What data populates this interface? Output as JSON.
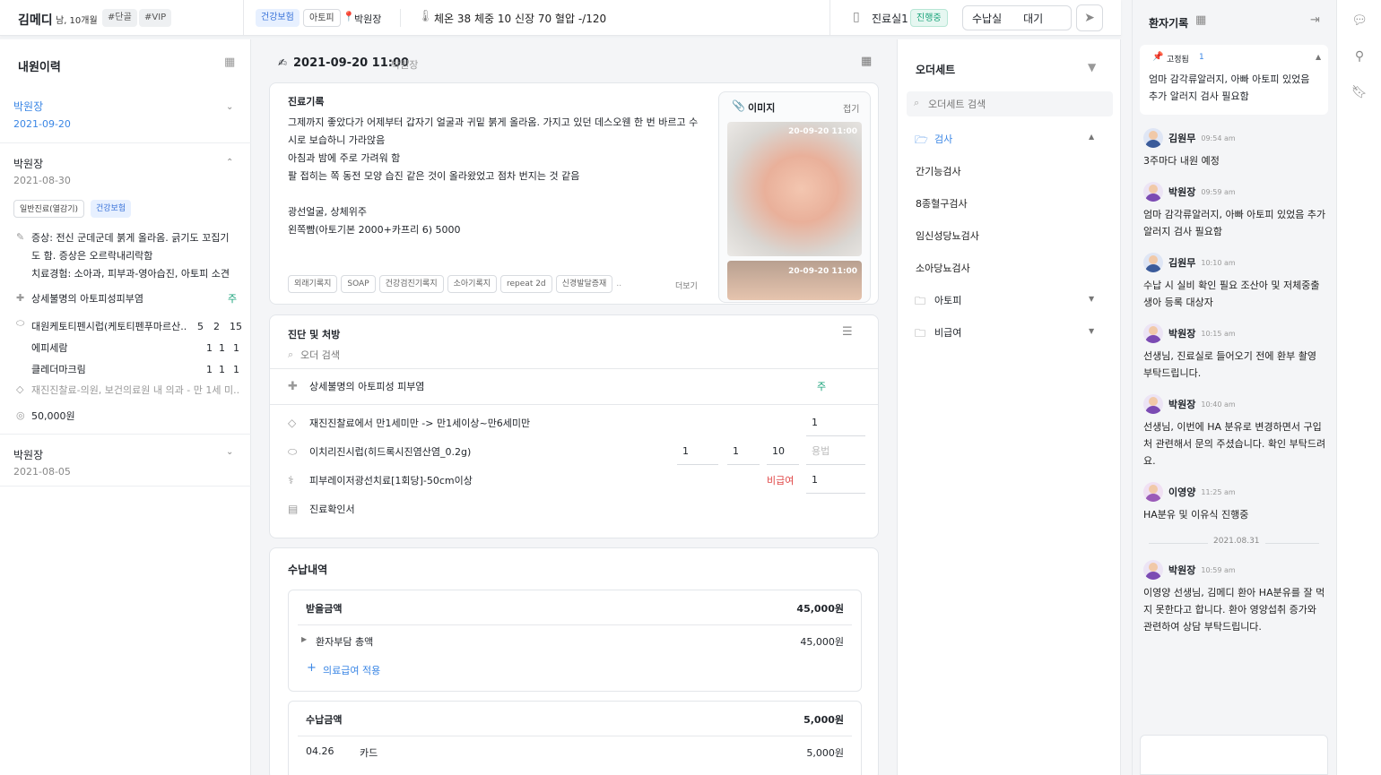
{
  "topbar": {
    "patient_name": "김메디",
    "patient_info": "남, 10개월",
    "tags": [
      "#단골",
      "#VIP"
    ],
    "insurance": "건강보험",
    "condition": "아토피",
    "doctor": "박원장",
    "vitals": "체온 38  체중 10 신장 70 혈압 -/120",
    "room": "진료실1",
    "room_status": "진행중",
    "dest": "수납실",
    "wait": "대기"
  },
  "history": {
    "title": "내원이력",
    "visits": [
      {
        "doctor": "박원장",
        "date": "2021-09-20"
      },
      {
        "doctor": "박원장",
        "date": "2021-08-30",
        "tags": [
          "일반진료(열감기)",
          "건강보험"
        ],
        "symptom1": "증상: 전신 군데군데 붉게 올라옴. 긁기도 꼬집기",
        "symptom2": "도 함. 증상은 오르락내리락함",
        "symptom3": "치료경험: 소아과, 피부과-영아습진, 아토피 소견",
        "diagnosis": "상세불명의 아토피성피부염",
        "diagnosis_flag": "주",
        "meds": [
          {
            "name": "대원케토티펜시럽(케토티펜푸마르산..",
            "a": "5",
            "b": "2",
            "c": "15"
          },
          {
            "name": "에피세람",
            "a": "1",
            "b": "1",
            "c": "1"
          },
          {
            "name": "클레더마크림",
            "a": "1",
            "b": "1",
            "c": "1"
          }
        ],
        "fee_item": "재진진찰료-의원, 보건의료원 내 의과 - 만 1세 미..",
        "amount": "50,000원"
      },
      {
        "doctor": "박원장",
        "date": "2021-08-05"
      }
    ]
  },
  "record": {
    "datetime": "2021-09-20 11:00",
    "doctor": "박원장",
    "title": "진료기록",
    "lines": [
      "그제까지 좋았다가 어제부터 갑자기 얼굴과 귀밑 붉게 올라옴. 가지고 있던 데스오웬 한 번 바르고 수",
      "시로 보습하니 가라앉음",
      "아침과 밤에 주로 가려워 함",
      "팔 접히는 쪽 동전 모양 습진 같은 것이 올라왔었고 점차 번지는 것 같음",
      "",
      "광선얼굴, 상체위주",
      "왼쪽뺨(아토기본 2000+카프리 6) 5000"
    ],
    "chips": [
      "외래기록지",
      "SOAP",
      "건강검진기록지",
      "소아기록지",
      "repeat 2d",
      "신경발달증재",
      ".."
    ],
    "more": "더보기",
    "image_title": "이미지",
    "image_fold": "접기",
    "image_stamp1": "20-09-20 11:00",
    "image_stamp2": "20-09-20 11:00"
  },
  "diag": {
    "title": "진단 및 처방",
    "search_placeholder": "오더 검색",
    "rows": [
      {
        "name": "상세불명의 아토피성 피부염",
        "flag": "주"
      },
      {
        "name": "재진진찰료에서 만1세미만 -> 만1세이상~만6세미만",
        "qty": "1"
      },
      {
        "name": "이치리진시럽(히드록시진염산염_0.2g)",
        "a": "1",
        "b": "1",
        "c": "10",
        "usage": "용법"
      },
      {
        "name": "피부레이저광선치료[1회당]-50cm이상",
        "flag": "비급여",
        "qty": "1"
      },
      {
        "name": "진료확인서"
      }
    ]
  },
  "payment": {
    "title": "수납내역",
    "receive_label": "받을금액",
    "receive_value": "45,000원",
    "patient_total_label": "환자부담 총액",
    "patient_total_value": "45,000원",
    "apply_label": "의료급여 적용",
    "paid_label": "수납금액",
    "paid_value": "5,000원",
    "paid_date": "04.26",
    "paid_method": "카드",
    "paid_amount": "5,000원"
  },
  "orderset": {
    "title": "오더세트",
    "search_placeholder": "오더세트 검색",
    "folder_open": "검사",
    "items": [
      "간기능검사",
      "8종혈구검사",
      "임신성당뇨검사",
      "소아당뇨검사"
    ],
    "folders": [
      "아토피",
      "비급여"
    ]
  },
  "chat": {
    "title": "환자기록",
    "pinned_label": "고정됨",
    "pinned_count": "1",
    "pinned_text": "엄마 감각류알러지, 아빠 아토피 있었음 추가 알러지 검사 필요함",
    "messages": [
      {
        "name": "김원무",
        "time": "09:54 am",
        "text": "3주마다 내원 예정"
      },
      {
        "name": "박원장",
        "time": "09:59 am",
        "text": "엄마 감각류알러지, 아빠 아토피 있었음 추가 알러지 검사 필요함"
      },
      {
        "name": "김원무",
        "time": "10:10 am",
        "text": "수납 시 실비 확인 필요 조산아 및 저체중출생아 등록 대상자"
      },
      {
        "name": "박원장",
        "time": "10:15 am",
        "text": "선생님, 진료실로 들어오기 전에 환부 촬영 부탁드립니다."
      },
      {
        "name": "박원장",
        "time": "10:40 am",
        "text": "선생님, 이번에 HA 분유로 변경하면서 구입처 관련해서 문의 주셨습니다. 확인 부탁드려요."
      },
      {
        "name": "이영양",
        "time": "11:25 am",
        "text": "HA분유 및 이유식 진행중"
      },
      {
        "name": "박원장",
        "time": "10:59 am",
        "text": "이영양 선생님, 김메디 환아 HA분유를 잘 먹지 못한다고 합니다. 환아 영양섭취 증가와 관련하여 상담 부탁드립니다."
      }
    ],
    "date_divider": "2021.08.31"
  }
}
